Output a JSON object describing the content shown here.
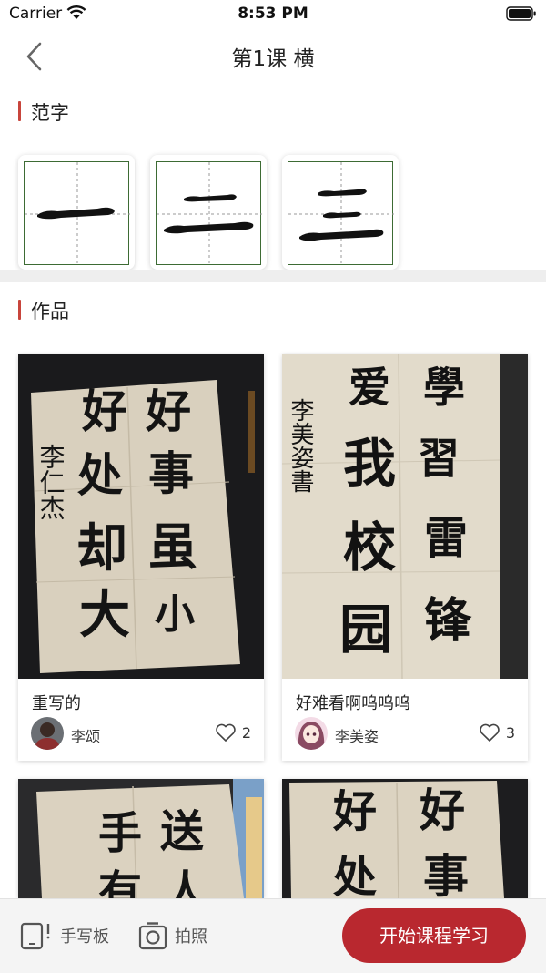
{
  "status_bar": {
    "carrier": "Carrier",
    "time": "8:53 PM"
  },
  "nav": {
    "title": "第1课 横",
    "back_icon": "chevron-left-icon"
  },
  "sections": {
    "samples_title": "范字",
    "works_title": "作品"
  },
  "samples": [
    {
      "name": "一"
    },
    {
      "name": "二"
    },
    {
      "name": "三"
    }
  ],
  "works": [
    {
      "caption": "重写的",
      "author": "李颂",
      "likes": "2",
      "photo_text": {
        "left": [
          "好",
          "处",
          "却",
          "大"
        ],
        "right": [
          "好",
          "事",
          "虽",
          "小"
        ],
        "sign": "李仁杰"
      }
    },
    {
      "caption": "好难看啊呜呜呜",
      "author": "李美姿",
      "likes": "3",
      "photo_text": {
        "left": [
          "爱",
          "我",
          "校",
          "园"
        ],
        "right": [
          "學",
          "習",
          "雷",
          "锋"
        ],
        "sign": "李美姿書"
      }
    },
    {
      "photo_text": {
        "left": [
          "手",
          "有"
        ],
        "right": [
          "送",
          "人"
        ]
      }
    },
    {
      "photo_text": {
        "left": [
          "好",
          "处"
        ],
        "right": [
          "好",
          "事"
        ]
      }
    }
  ],
  "bottom_bar": {
    "tablet_label": "手写板",
    "camera_label": "拍照",
    "start_label": "开始课程学习"
  },
  "colors": {
    "accent": "#b9282f",
    "section_bar": "#c8453c",
    "grid_line": "#3d6b34"
  }
}
